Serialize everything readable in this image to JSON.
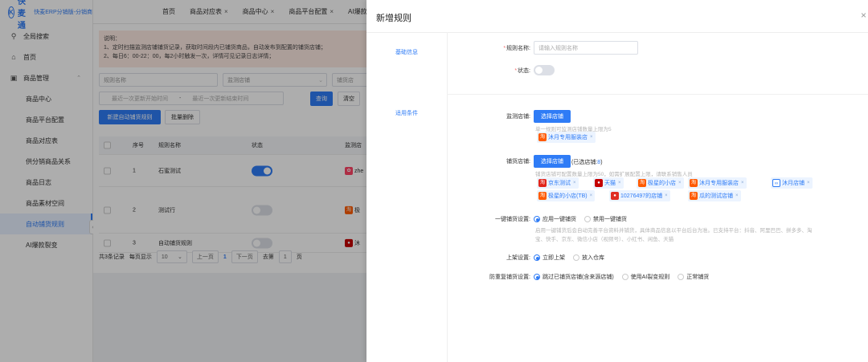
{
  "app": {
    "logo_letter": "K",
    "name": "快麦通",
    "subtitle": "快麦ERP分销版-分销商"
  },
  "sidebar": {
    "search": "全局搜索",
    "home": "首页",
    "group": "商品管理",
    "items": [
      "商品中心",
      "商品平台配置",
      "商品对应表",
      "供分销商品关系",
      "商品日志",
      "商品素材空间",
      "自动铺货规则",
      "AI爆款裂变"
    ],
    "active_index": 6
  },
  "tabs": [
    {
      "label": "首页",
      "closable": false
    },
    {
      "label": "商品对应表",
      "closable": true
    },
    {
      "label": "商品中心",
      "closable": true
    },
    {
      "label": "商品平台配置",
      "closable": true
    },
    {
      "label": "AI爆款裂",
      "closable": false
    }
  ],
  "notice": {
    "title": "说明：",
    "line1": "1、定时扫描监测店铺铺货记录，获取时间段内已铺货商品，自动发布到配置的铺货店铺；",
    "line2": "2、每日6：00-22：00，每2小时触发一次，详情可见记录日志详情；"
  },
  "filters": {
    "rule_name": "规则名称",
    "monitor_shop": "监测店铺",
    "distribute_shop": "铺货店",
    "start_time": "最近一次更新开始时间",
    "dash": "-",
    "end_time": "最近一次更新结束时间",
    "query": "查询",
    "clear": "清空"
  },
  "actions": {
    "new_rule": "新建自动铺货规则",
    "batch_delete": "批量删除"
  },
  "table": {
    "headers": [
      "序号",
      "规则名称",
      "状态",
      "监测店"
    ],
    "rows": [
      {
        "no": "1",
        "name": "石蜜测试",
        "enabled": true,
        "shop": "zhe"
      },
      {
        "no": "2",
        "name": "测试行",
        "enabled": false,
        "shop": "极"
      },
      {
        "no": "3",
        "name": "自动铺货规则",
        "enabled": false,
        "shop": "沐"
      }
    ]
  },
  "pager": {
    "total": "共3条记录",
    "per_page_label": "每页显示",
    "per_page": "10",
    "prev": "上一页",
    "page": "1",
    "next": "下一页",
    "goto": "去第",
    "goto_page": "1",
    "page_unit": "页"
  },
  "drawer": {
    "title": "新增规则",
    "close": "×",
    "section_basic": "基础信息",
    "section_cond": "适用条件",
    "rule_name_label": "规则名称:",
    "rule_name_placeholder": "请输入规则名称",
    "status_label": "状态:",
    "monitor_label": "监测店铺:",
    "select_shop": "选择店铺",
    "monitor_hint": "单一规则可监测店铺数量上限为5",
    "monitor_tags": [
      {
        "label": "沐月专用服装店",
        "icon": "taobao"
      }
    ],
    "distribute_label": "铺货店铺:",
    "selected_prefix": "(已选店铺:",
    "selected_count": "8",
    "selected_suffix": ")",
    "distribute_hint": "铺货店铺可配置数量上限为50，如需扩展配置上限，请联系销售人员",
    "distribute_tags": [
      {
        "label": "京东测试",
        "icon": "jd"
      },
      {
        "label": "天猫",
        "icon": "tmall"
      },
      {
        "label": "极星的小店",
        "icon": "taobao"
      },
      {
        "label": "沐月专用服装店",
        "icon": "taobao"
      },
      {
        "label": "沐月店铺",
        "icon": "link"
      },
      {
        "label": "极星的小店(TB)",
        "icon": "taobao"
      },
      {
        "label": "10276497的店铺",
        "icon": "pdd"
      },
      {
        "label": "瓜的测试店铺",
        "icon": "taobao"
      }
    ],
    "onekey_label": "一键铺货设置:",
    "onekey_opt1": "应用一键铺货",
    "onekey_opt2": "禁用一键铺货",
    "onekey_hint1": "启用一键铺货后会自动完善平台资料并铺货，具体商品信息以平台后台为准。已支持平台：抖音、阿里巴巴、拼多多、淘",
    "onekey_hint2": "宝、快手、京东、微信小店（视频号）、小红书、闲鱼、天猫",
    "shelf_label": "上架设置:",
    "shelf_opt1": "立即上架",
    "shelf_opt2": "放入仓库",
    "dedupe_label": "防重复铺货设置:",
    "dedupe_opt1": "跳过已铺货店铺(含来源店铺)",
    "dedupe_opt2": "使用AI裂变规则",
    "dedupe_opt3": "正常铺货"
  },
  "colors": {
    "primary": "#2f7cf6",
    "taobao": "#ff5a00",
    "jd": "#e1251b",
    "pdd": "#e02e24",
    "tmall": "#c40000"
  }
}
